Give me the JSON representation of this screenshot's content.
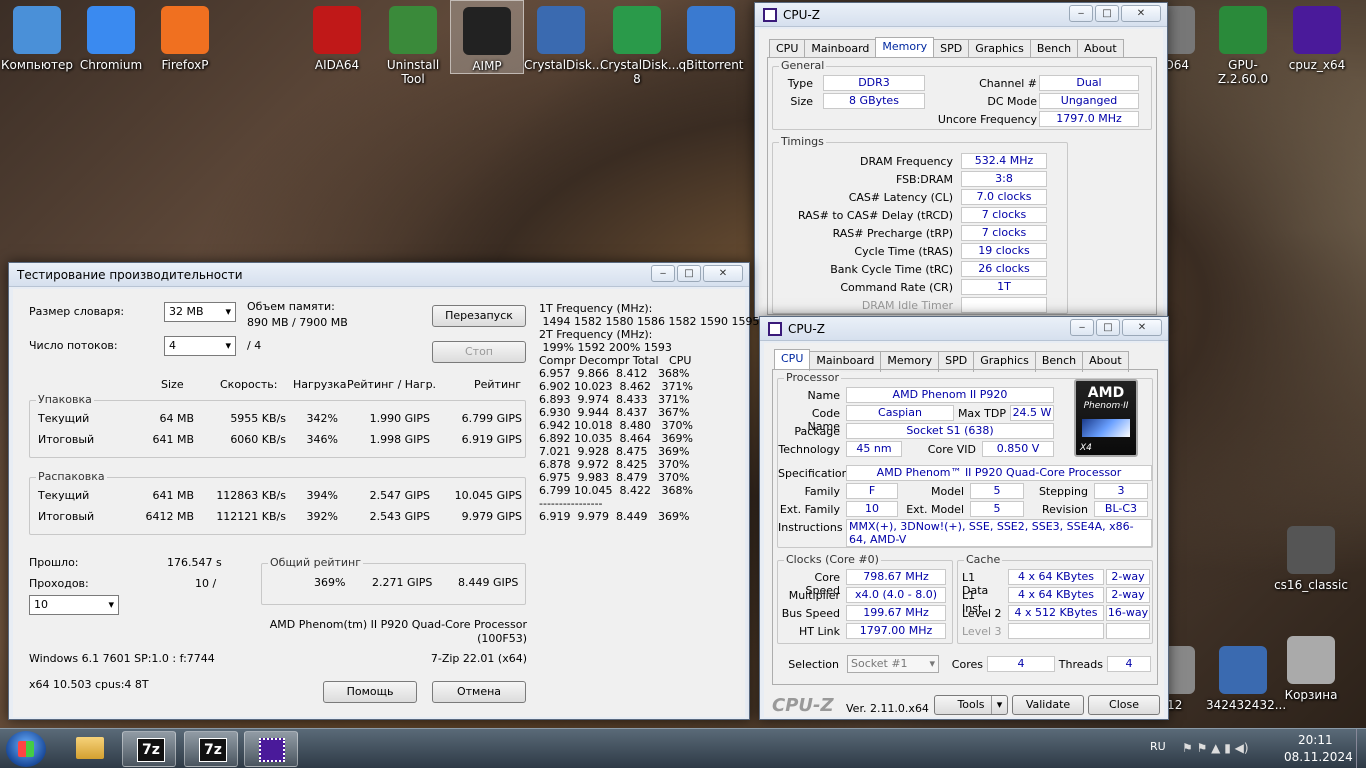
{
  "desktop_icons": [
    {
      "label": "Компьютер",
      "icon": "computer-icon"
    },
    {
      "label": "Chromium",
      "icon": "chromium-icon"
    },
    {
      "label": "FirefoxP",
      "icon": "firefox-icon"
    },
    {
      "label": "AIDA64",
      "icon": "aida64-icon"
    },
    {
      "label": "Uninstall Tool",
      "icon": "uninstall-tool-icon"
    },
    {
      "label": "AIMP",
      "icon": "aimp-icon"
    },
    {
      "label": "CrystalDisk...",
      "icon": "crystaldisk-icon"
    },
    {
      "label": "CrystalDisk... 8",
      "icon": "crystaldisk8-icon"
    },
    {
      "label": "qBittorrent",
      "icon": "qbittorrent-icon"
    },
    {
      "label": "...O64",
      "icon": "app-icon"
    },
    {
      "label": "GPU-Z.2.60.0",
      "icon": "gpuz-icon"
    },
    {
      "label": "cpuz_x64",
      "icon": "cpuz-icon"
    },
    {
      "label": "cs16_classic",
      "icon": "cs16-icon"
    },
    {
      "label": "e12",
      "icon": "app-icon"
    },
    {
      "label": "342432432...",
      "icon": "image-icon"
    },
    {
      "label": "Корзина",
      "icon": "recycle-bin-icon"
    }
  ],
  "cpuz_mem": {
    "title": "CPU-Z",
    "tabs": [
      "CPU",
      "Mainboard",
      "Memory",
      "SPD",
      "Graphics",
      "Bench",
      "About"
    ],
    "general_label": "General",
    "type_label": "Type",
    "type": "DDR3",
    "size_label": "Size",
    "size": "8 GBytes",
    "channel_label": "Channel #",
    "channel": "Dual",
    "dcmode_label": "DC Mode",
    "dcmode": "Unganged",
    "uncore_label": "Uncore Frequency",
    "uncore": "1797.0 MHz",
    "timings_label": "Timings",
    "timings": [
      {
        "label": "DRAM Frequency",
        "value": "532.4 MHz"
      },
      {
        "label": "FSB:DRAM",
        "value": "3:8"
      },
      {
        "label": "CAS# Latency (CL)",
        "value": "7.0 clocks"
      },
      {
        "label": "RAS# to CAS# Delay (tRCD)",
        "value": "7 clocks"
      },
      {
        "label": "RAS# Precharge (tRP)",
        "value": "7 clocks"
      },
      {
        "label": "Cycle Time (tRAS)",
        "value": "19 clocks"
      },
      {
        "label": "Bank Cycle Time (tRC)",
        "value": "26 clocks"
      },
      {
        "label": "Command Rate (CR)",
        "value": "1T"
      },
      {
        "label": "DRAM Idle Timer",
        "value": ""
      }
    ]
  },
  "cpuz_cpu": {
    "title": "CPU-Z",
    "tabs": [
      "CPU",
      "Mainboard",
      "Memory",
      "SPD",
      "Graphics",
      "Bench",
      "About"
    ],
    "processor_label": "Processor",
    "name_label": "Name",
    "name": "AMD Phenom II P920",
    "codename_label": "Code Name",
    "codename": "Caspian",
    "maxtdp_label": "Max TDP",
    "maxtdp": "24.5 W",
    "package_label": "Package",
    "package": "Socket S1 (638)",
    "tech_label": "Technology",
    "tech": "45 nm",
    "vid_label": "Core VID",
    "vid": "0.850 V",
    "spec_label": "Specification",
    "spec": "AMD Phenom™ II P920 Quad-Core Processor",
    "family_label": "Family",
    "family": "F",
    "model_label": "Model",
    "model": "5",
    "stepping_label": "Stepping",
    "stepping": "3",
    "extfamily_label": "Ext. Family",
    "extfamily": "10",
    "extmodel_label": "Ext. Model",
    "extmodel": "5",
    "revision_label": "Revision",
    "revision": "BL-C3",
    "instr_label": "Instructions",
    "instr": "MMX(+), 3DNow!(+), SSE, SSE2, SSE3, SSE4A, x86-64, AMD-V",
    "logo_brand": "AMD",
    "logo_sub": "Phenom·II",
    "logo_x4": "X4",
    "clocks_label": "Clocks (Core #0)",
    "corespeed_label": "Core Speed",
    "corespeed": "798.67 MHz",
    "mult_label": "Multiplier",
    "mult": "x4.0 (4.0 - 8.0)",
    "bus_label": "Bus Speed",
    "bus": "199.67 MHz",
    "ht_label": "HT Link",
    "ht": "1797.00 MHz",
    "cache_label": "Cache",
    "l1d_label": "L1 Data",
    "l1d": "4 x 64 KBytes",
    "l1d_way": "2-way",
    "l1i_label": "L1 Inst.",
    "l1i": "4 x 64 KBytes",
    "l1i_way": "2-way",
    "l2_label": "Level 2",
    "l2": "4 x 512 KBytes",
    "l2_way": "16-way",
    "l3_label": "Level 3",
    "selection_label": "Selection",
    "selection": "Socket #1",
    "cores_label": "Cores",
    "cores": "4",
    "threads_label": "Threads",
    "threads": "4",
    "brand": "CPU-Z",
    "version": "Ver. 2.11.0.x64",
    "tools": "Tools",
    "validate": "Validate",
    "close": "Close"
  },
  "sevenzip": {
    "title": "Тестирование производительности",
    "dict_label": "Размер словаря:",
    "dict": "32 MB",
    "memory_label": "Объем памяти:",
    "memory": "890 MB / 7900 MB",
    "threads_label": "Число потоков:",
    "threads": "4",
    "threads_of": "/ 4",
    "restart": "Перезапуск",
    "stop": "Стоп",
    "col_size": "Size",
    "col_speed": "Скорость:",
    "col_usage": "Нагрузка",
    "col_rpu": "Рейтинг / Нагр.",
    "col_rating": "Рейтинг",
    "pack_label": "Упаковка",
    "pack_rows": [
      {
        "name": "Текущий",
        "size": "64 MB",
        "speed": "5955 KB/s",
        "usage": "342%",
        "rpu": "1.990 GIPS",
        "rating": "6.799 GIPS"
      },
      {
        "name": "Итоговый",
        "size": "641 MB",
        "speed": "6060 KB/s",
        "usage": "346%",
        "rpu": "1.998 GIPS",
        "rating": "6.919 GIPS"
      }
    ],
    "unpack_label": "Распаковка",
    "unpack_rows": [
      {
        "name": "Текущий",
        "size": "641 MB",
        "speed": "112863 KB/s",
        "usage": "394%",
        "rpu": "2.547 GIPS",
        "rating": "10.045 GIPS"
      },
      {
        "name": "Итоговый",
        "size": "6412 MB",
        "speed": "112121 KB/s",
        "usage": "392%",
        "rpu": "2.543 GIPS",
        "rating": "9.979 GIPS"
      }
    ],
    "elapsed_label": "Прошло:",
    "elapsed": "176.547 s",
    "passes_label": "Проходов:",
    "passes": "10 /",
    "passes_select": "10",
    "total_label": "Общий рейтинг",
    "total_usage": "369%",
    "total_rpu": "2.271 GIPS",
    "total_rating": "8.449 GIPS",
    "cpu_name": "AMD Phenom(tm) II P920 Quad-Core Processor",
    "cpu_id": "(100F53)",
    "os": "Windows 6.1 7601 SP:1.0 : f:7744",
    "version": "7-Zip 22.01 (x64)",
    "arch": "x64 10.503 cpus:4 8T",
    "help": "Помощь",
    "cancel": "Отмена",
    "log": "1T Frequency (MHz):\n 1494 1582 1580 1586 1582 1590 1595\n2T Frequency (MHz):\n 199% 1592 200% 1593\nCompr Decompr Total   CPU\n6.957  9.866  8.412   368%\n6.902 10.023  8.462   371%\n6.893  9.974  8.433   371%\n6.930  9.944  8.437   367%\n6.942 10.018  8.480   370%\n6.892 10.035  8.464   369%\n7.021  9.928  8.475   369%\n6.878  9.972  8.425   370%\n6.975  9.983  8.479   370%\n6.799 10.045  8.422   368%\n----------------\n6.919  9.979  8.449   369%"
  },
  "taskbar": {
    "lang": "RU",
    "time": "20:11",
    "date": "08.11.2024"
  }
}
